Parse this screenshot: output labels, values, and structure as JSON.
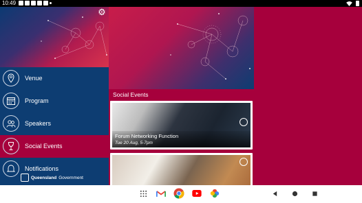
{
  "status_bar": {
    "time": "10:49",
    "notification_icons": [
      "mail-icon",
      "chat-icon",
      "chat-icon",
      "chat-icon",
      "chat-icon",
      "dot-icon"
    ],
    "right_icons": [
      "wifi-icon",
      "battery-icon"
    ]
  },
  "drawer": {
    "settings_icon": "gear-icon",
    "items": [
      {
        "label": "Venue",
        "icon": "map-pin-icon",
        "active": false
      },
      {
        "label": "Program",
        "icon": "calendar-icon",
        "active": false
      },
      {
        "label": "Speakers",
        "icon": "people-icon",
        "active": false
      },
      {
        "label": "Social Events",
        "icon": "wine-glass-icon",
        "active": true
      },
      {
        "label": "Notifications",
        "icon": "bell-icon",
        "active": false
      }
    ],
    "footer": {
      "brand_bold": "Queensland",
      "brand_rest": "Government"
    }
  },
  "main": {
    "section_title": "Social Events",
    "cards": [
      {
        "title": "Forum Networking Function",
        "date": "Tue 20 Aug, 5-7pm"
      },
      {
        "title": "",
        "date": ""
      }
    ]
  },
  "nav_bar": {
    "dock_apps": [
      "app-drawer-icon",
      "gmail-icon",
      "chrome-icon",
      "youtube-icon",
      "photos-icon"
    ],
    "buttons": [
      "back-button",
      "home-button",
      "recents-button"
    ]
  },
  "colors": {
    "navy": "#0d3d72",
    "crimson": "#a6003c"
  }
}
